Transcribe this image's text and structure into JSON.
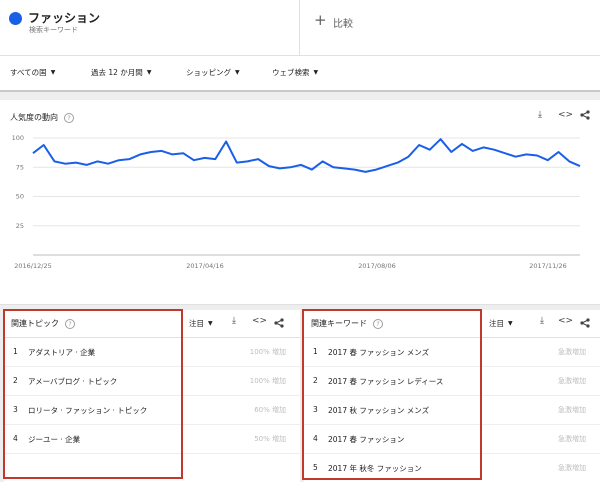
{
  "term": {
    "title": "ファッション",
    "subtitle": "検索キーワード",
    "color": "#1a5fe8"
  },
  "compare": {
    "label": "比較"
  },
  "filters": [
    {
      "label": "すべての国"
    },
    {
      "label": "過去 12 か月間"
    },
    {
      "label": "ショッピング"
    },
    {
      "label": "ウェブ検索"
    }
  ],
  "interest": {
    "title": "人気度の動向"
  },
  "chart_data": {
    "type": "line",
    "ylim": [
      0,
      100
    ],
    "yticks": [
      25,
      50,
      75,
      100
    ],
    "xtick_labels": [
      "2016/12/25",
      "2017/04/16",
      "2017/08/06",
      "2017/11/26"
    ],
    "series": [
      {
        "values": [
          87,
          94,
          80,
          78,
          79,
          77,
          80,
          78,
          81,
          82,
          86,
          88,
          89,
          86,
          87,
          81,
          83,
          82,
          97,
          79,
          80,
          82,
          76,
          74,
          75,
          77,
          73,
          80,
          75,
          74,
          73,
          71,
          73,
          76,
          79,
          84,
          94,
          90,
          99,
          88,
          95,
          89,
          92,
          90,
          87,
          84,
          86,
          85,
          81,
          88,
          80,
          76
        ],
        "color": "#1a5fe8"
      }
    ]
  },
  "topics": {
    "title": "関連トピック",
    "sort_label": "注目",
    "rows": [
      {
        "rank": "1",
        "name": "アダストリア · 企業",
        "value": "100% 増加"
      },
      {
        "rank": "2",
        "name": "アメーバブログ · トピック",
        "value": "100% 増加"
      },
      {
        "rank": "3",
        "name": "ロリータ · ファッション · トピック",
        "value": "60% 増加"
      },
      {
        "rank": "4",
        "name": "ジーユー · 企業",
        "value": "50% 増加"
      }
    ]
  },
  "queries": {
    "title": "関連キーワード",
    "sort_label": "注目",
    "rows": [
      {
        "rank": "1",
        "name": "2017 春 ファッション メンズ",
        "value": "急激増加"
      },
      {
        "rank": "2",
        "name": "2017 春 ファッション レディース",
        "value": "急激増加"
      },
      {
        "rank": "3",
        "name": "2017 秋 ファッション メンズ",
        "value": "急激増加"
      },
      {
        "rank": "4",
        "name": "2017 春 ファッション",
        "value": "急激増加"
      },
      {
        "rank": "5",
        "name": "2017 年 秋冬 ファッション",
        "value": "急激増加"
      }
    ]
  },
  "icons": {
    "download": "download-icon",
    "embed": "embed-icon",
    "share": "share-icon",
    "help": "help-icon",
    "caret": "caret-down-icon"
  },
  "highlight_color": "#c0392b"
}
